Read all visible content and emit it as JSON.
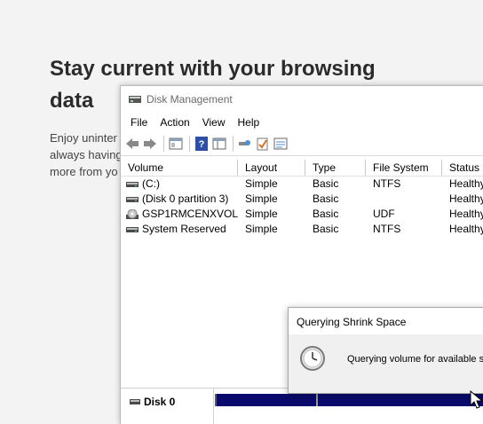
{
  "background": {
    "heading_lines": [
      "Stay current with your browsing",
      "data"
    ],
    "paragraph_lines": [
      "Enjoy uninter",
      "always having",
      "more from yo"
    ]
  },
  "window": {
    "title": "Disk Management",
    "menu": [
      "File",
      "Action",
      "View",
      "Help"
    ],
    "toolbar_icons": [
      "back-arrow-icon",
      "forward-arrow-icon",
      "properties-icon",
      "help-icon",
      "console-tree-icon",
      "search-icon",
      "check-icon",
      "list-icon"
    ]
  },
  "volumes": {
    "columns": [
      "Volume",
      "Layout",
      "Type",
      "File System",
      "Status"
    ],
    "rows": [
      {
        "volume": "(C:)",
        "layout": "Simple",
        "type": "Basic",
        "fs": "NTFS",
        "status": "Healthy",
        "icon": "drive-icon"
      },
      {
        "volume": "(Disk 0 partition 3)",
        "layout": "Simple",
        "type": "Basic",
        "fs": "",
        "status": "Healthy",
        "icon": "drive-icon"
      },
      {
        "volume": "GSP1RMCENXVOL...",
        "layout": "Simple",
        "type": "Basic",
        "fs": "UDF",
        "status": "Healthy",
        "icon": "cd-drive-icon"
      },
      {
        "volume": "System Reserved",
        "layout": "Simple",
        "type": "Basic",
        "fs": "NTFS",
        "status": "Healthy",
        "icon": "drive-icon"
      }
    ]
  },
  "disk_pane": {
    "disk_label": "Disk 0"
  },
  "dialog": {
    "title": "Querying Shrink Space",
    "message": "Querying volume for available sh"
  }
}
